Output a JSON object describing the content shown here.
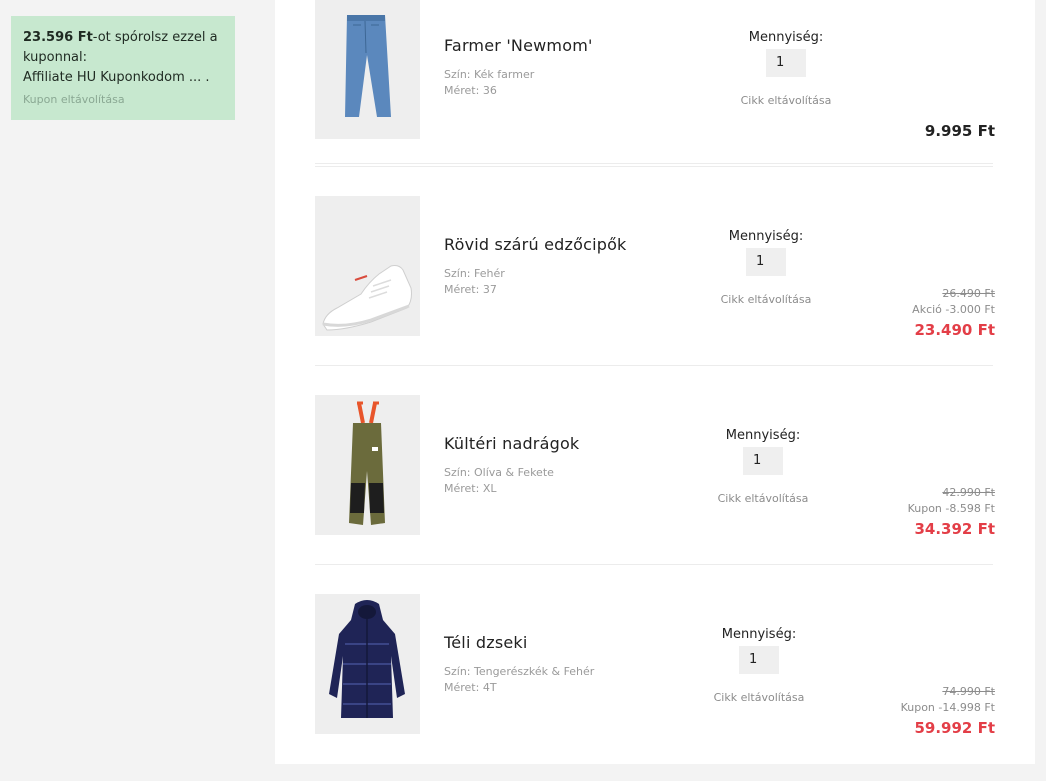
{
  "coupon": {
    "amount": "23.596 Ft",
    "text_after_amount": "-ot spórolsz ezzel a kuponnal:",
    "code": "Affiliate HU Kuponkodom ... .",
    "remove": "Kupon eltávolítása"
  },
  "items": [
    {
      "name": "Farmer 'Newmom'",
      "color": "Szín: Kék farmer",
      "size": "Méret: 36",
      "qty_label": "Mennyiség:",
      "qty": "1",
      "remove": "Cikk eltávolítása",
      "old_price": "",
      "discount": "",
      "price": "9.995 Ft"
    },
    {
      "name": "Rövid szárú edzőcipők",
      "color": "Szín: Fehér",
      "size": "Méret: 37",
      "qty_label": "Mennyiség:",
      "qty": "1",
      "remove": "Cikk eltávolítása",
      "old_price": "26.490 Ft",
      "discount": "Akció -3.000 Ft",
      "price": "23.490 Ft"
    },
    {
      "name": "Kültéri nadrágok",
      "color": "Szín: Olíva & Fekete",
      "size": "Méret: XL",
      "qty_label": "Mennyiség:",
      "qty": "1",
      "remove": "Cikk eltávolítása",
      "old_price": "42.990 Ft",
      "discount": "Kupon -8.598 Ft",
      "price": "34.392 Ft"
    },
    {
      "name": "Téli dzseki",
      "color": "Szín: Tengerészkék & Fehér",
      "size": "Méret: 4T",
      "qty_label": "Mennyiség:",
      "qty": "1",
      "remove": "Cikk eltávolítása",
      "old_price": "74.990 Ft",
      "discount": "Kupon -14.998 Ft",
      "price": "59.992 Ft"
    }
  ],
  "colors": {
    "coupon_bg": "#c7e8cf",
    "sale_red": "#e33e47",
    "panel_bg": "#ffffff",
    "page_bg": "#f3f3f3"
  }
}
